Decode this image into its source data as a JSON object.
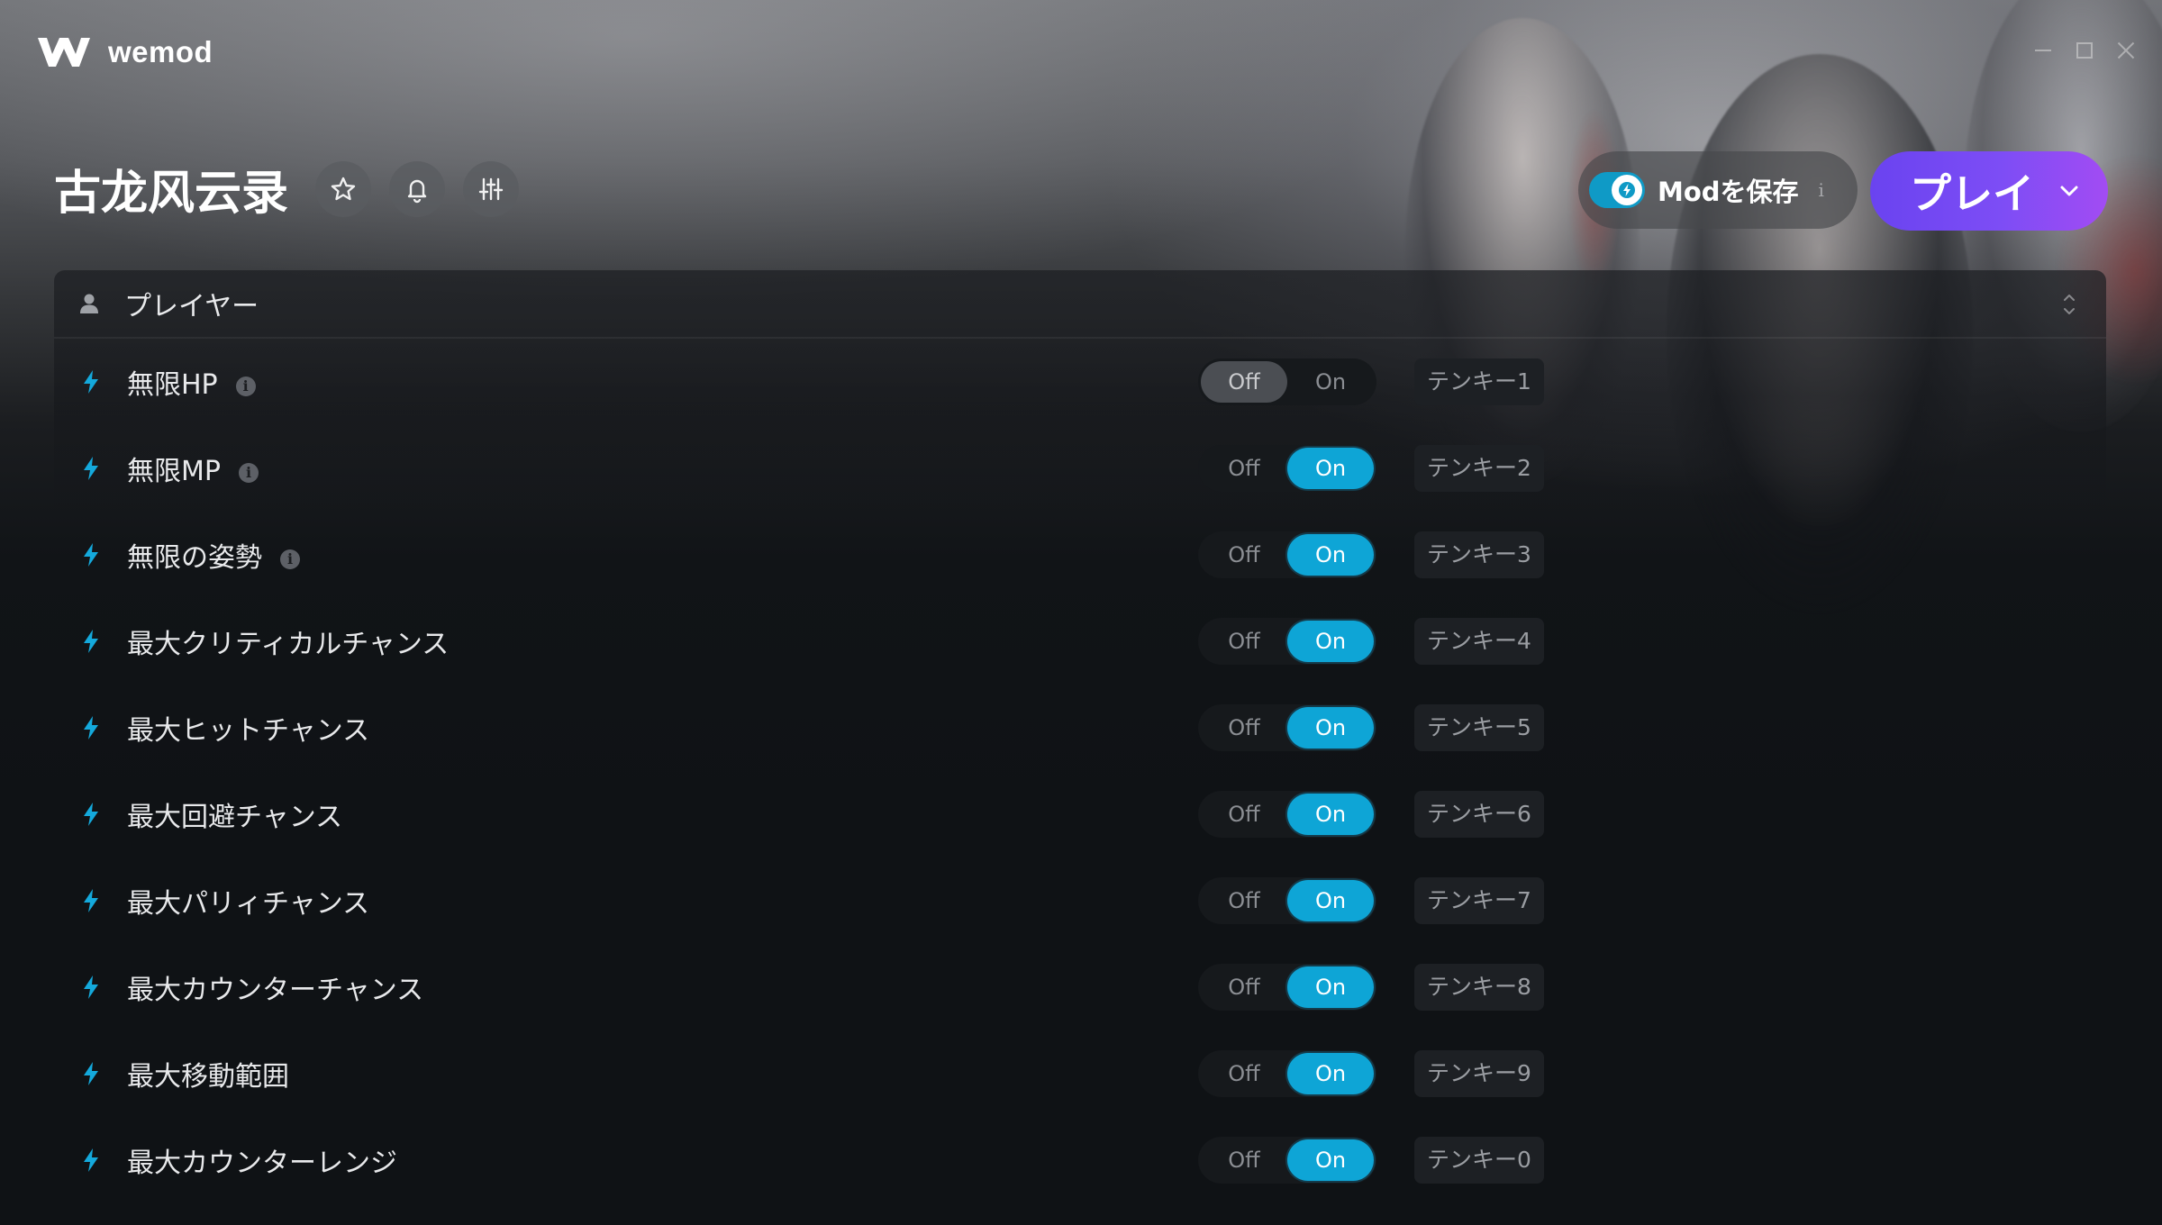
{
  "app": {
    "name": "wemod"
  },
  "game": {
    "title": "古龙风云录"
  },
  "header_actions": {
    "favorite_icon": "star-icon",
    "notify_icon": "bell-icon",
    "settings_icon": "sliders-icon"
  },
  "save_mods": {
    "label": "Modを保存",
    "enabled": true,
    "info": "i"
  },
  "play": {
    "label": "プレイ"
  },
  "category": {
    "title": "プレイヤー",
    "icon": "person-icon"
  },
  "toggle_labels": {
    "off": "Off",
    "on": "On"
  },
  "colors": {
    "accent": "#0ea5d6",
    "play_gradient_start": "#6a43f0",
    "play_gradient_end": "#a24cf3",
    "background": "#0f1215"
  },
  "mods": [
    {
      "name": "無限HP",
      "has_info": true,
      "state": "off",
      "hotkey": "テンキー1"
    },
    {
      "name": "無限MP",
      "has_info": true,
      "state": "on",
      "hotkey": "テンキー2"
    },
    {
      "name": "無限の姿勢",
      "has_info": true,
      "state": "on",
      "hotkey": "テンキー3"
    },
    {
      "name": "最大クリティカルチャンス",
      "has_info": false,
      "state": "on",
      "hotkey": "テンキー4"
    },
    {
      "name": "最大ヒットチャンス",
      "has_info": false,
      "state": "on",
      "hotkey": "テンキー5"
    },
    {
      "name": "最大回避チャンス",
      "has_info": false,
      "state": "on",
      "hotkey": "テンキー6"
    },
    {
      "name": "最大パリィチャンス",
      "has_info": false,
      "state": "on",
      "hotkey": "テンキー7"
    },
    {
      "name": "最大カウンターチャンス",
      "has_info": false,
      "state": "on",
      "hotkey": "テンキー8"
    },
    {
      "name": "最大移動範囲",
      "has_info": false,
      "state": "on",
      "hotkey": "テンキー9"
    },
    {
      "name": "最大カウンターレンジ",
      "has_info": false,
      "state": "on",
      "hotkey": "テンキー0"
    }
  ]
}
